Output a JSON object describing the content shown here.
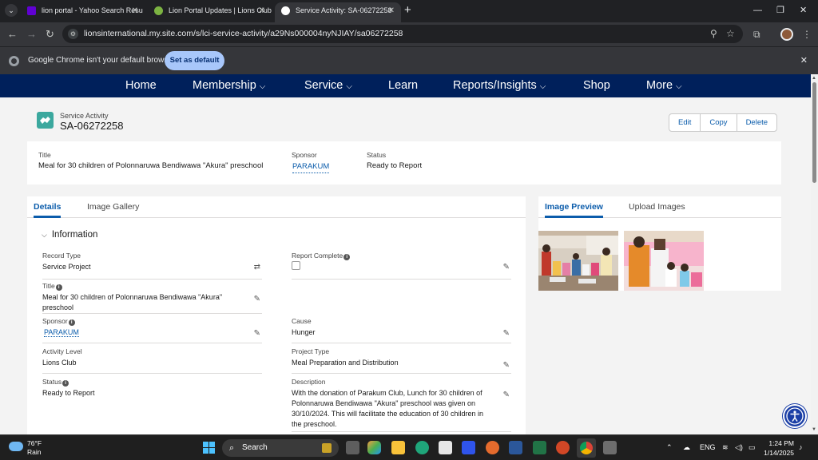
{
  "browser": {
    "tabs": [
      {
        "title": "lion portal - Yahoo Search Resu",
        "favicon_color": "#6001d2"
      },
      {
        "title": "Lion Portal Updates | Lions Club",
        "favicon_color": "#7cb342"
      },
      {
        "title": "Service Activity: SA-06272258",
        "favicon_color": "#ffffff"
      }
    ],
    "url": "lionsinternational.my.site.com/s/lci-service-activity/a29Ns000004nyNJIAY/sa06272258",
    "infobar": {
      "message": "Google Chrome isn't your default browser",
      "button": "Set as default"
    }
  },
  "nav": {
    "items": [
      "Home",
      "Membership",
      "Service",
      "Learn",
      "Reports/Insights",
      "Shop",
      "More"
    ]
  },
  "record": {
    "type": "Service Activity",
    "name": "SA-06272258",
    "actions": [
      "Edit",
      "Copy",
      "Delete"
    ]
  },
  "highlights": {
    "title_label": "Title",
    "title_value": "Meal for 30 children of Polonnaruwa Bendiwawa \"Akura\" preschool",
    "sponsor_label": "Sponsor",
    "sponsor_value": "PARAKUM",
    "status_label": "Status",
    "status_value": "Ready to Report"
  },
  "details": {
    "tabs": [
      "Details",
      "Image Gallery"
    ],
    "section_title": "Information",
    "fields": {
      "record_type": {
        "label": "Record Type",
        "value": "Service Project"
      },
      "report_complete": {
        "label": "Report Complete",
        "checked": false
      },
      "title": {
        "label": "Title",
        "value": "Meal for 30 children of Polonnaruwa Bendiwawa \"Akura\" preschool"
      },
      "sponsor": {
        "label": "Sponsor",
        "value": "PARAKUM"
      },
      "cause": {
        "label": "Cause",
        "value": "Hunger"
      },
      "activity_level": {
        "label": "Activity Level",
        "value": "Lions Club"
      },
      "project_type": {
        "label": "Project Type",
        "value": "Meal Preparation and Distribution"
      },
      "status": {
        "label": "Status",
        "value": "Ready to Report"
      },
      "description": {
        "label": "Description",
        "value": "With the donation of Parakum Club, Lunch for 30 children of Polonnaruwa Bendiwawa \"Akura\" preschool was given on 30/10/2024. This will facilitate the education of 30 children in the preschool."
      }
    }
  },
  "preview": {
    "tabs": [
      "Image Preview",
      "Upload Images"
    ]
  },
  "taskbar": {
    "weather_temp": "76°F",
    "weather_cond": "Rain",
    "search_placeholder": "Search",
    "lang": "ENG",
    "time": "1:24 PM",
    "date": "1/14/2025"
  },
  "colors": {
    "nav_bg": "#00205b",
    "link": "#0b5cab",
    "record_icon": "#3ba89e"
  }
}
